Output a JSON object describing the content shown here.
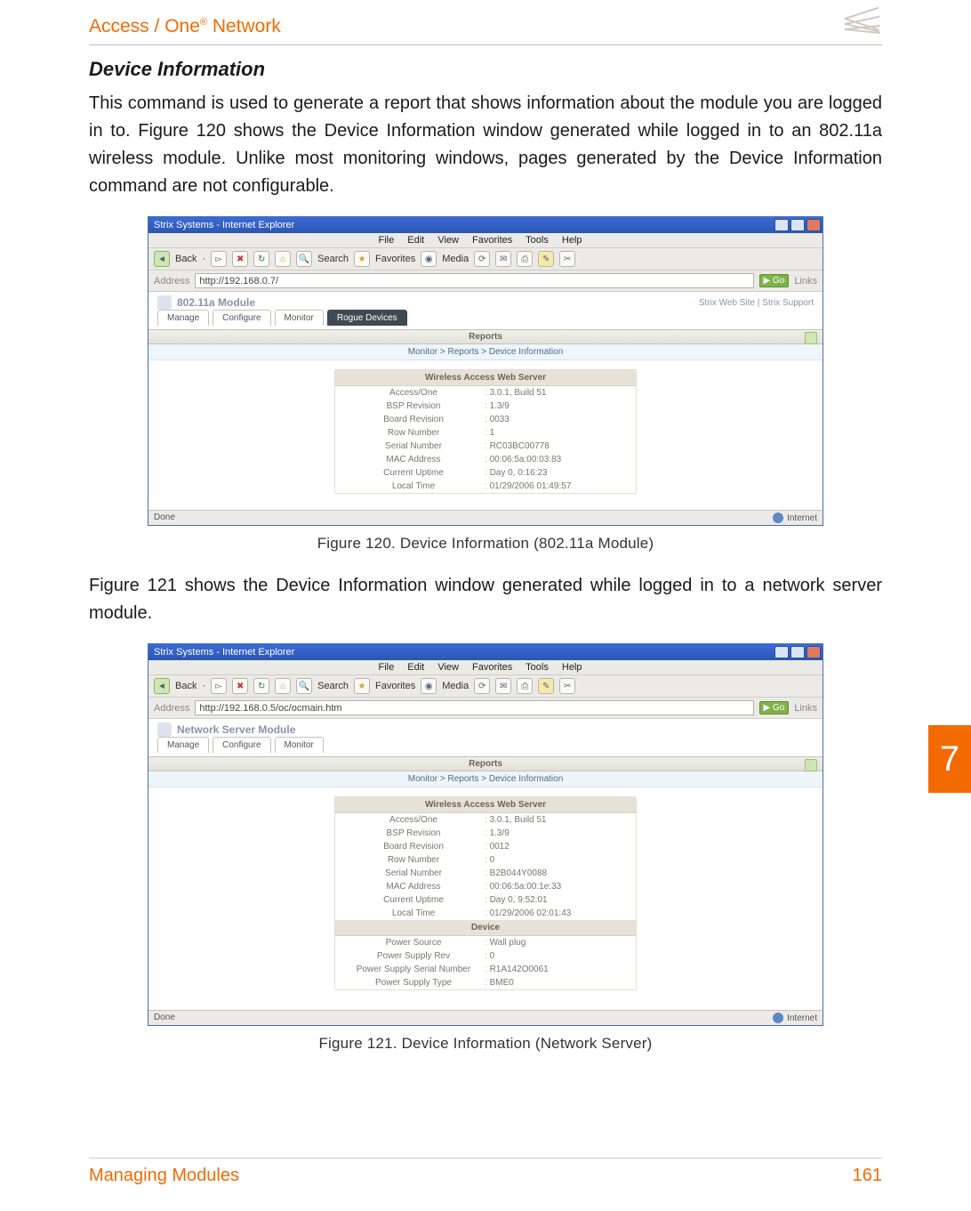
{
  "header": {
    "product_line": "Access / One",
    "reg": "®",
    "suffix": " Network"
  },
  "section_title": "Device Information",
  "para1": "This command is used to generate a report that shows information about the module you are logged in to. Figure 120 shows the Device Information window generated while logged in to an 802.11a wireless module. Unlike most monitoring windows, pages generated by the Device Information command are not configurable.",
  "para2": "Figure 121 shows the Device Information window generated while logged in to a network server module.",
  "fig120_caption": "Figure 120. Device Information (802.11a Module)",
  "fig121_caption": "Figure 121. Device Information (Network Server)",
  "chapter_tab": "7",
  "footer": {
    "left": "Managing Modules",
    "right": "161"
  },
  "ie": {
    "title": "Strix Systems - Internet Explorer",
    "menu": {
      "file": "File",
      "edit": "Edit",
      "view": "View",
      "favorites": "Favorites",
      "tools": "Tools",
      "help": "Help"
    },
    "toolbar": {
      "back": "Back",
      "search": "Search",
      "favorites": "Favorites",
      "media": "Media"
    },
    "addr_label": "Address",
    "go": "Go",
    "links": "Links",
    "status_done": "Done",
    "status_net": "Internet"
  },
  "screenshot120": {
    "url": "http://192.168.0.7/",
    "module": "802.11a Module",
    "top_links": "Strix Web Site  |  Strix Support",
    "tabs": {
      "manage": "Manage",
      "configure": "Configure",
      "monitor": "Monitor",
      "rogue": "Rogue Devices"
    },
    "reports_label": "Reports",
    "breadcrumb": "Monitor > Reports > Device Information",
    "card_header": "Wireless Access Web Server",
    "rows": [
      {
        "k": "Access/One",
        "v": "3.0.1, Build 51"
      },
      {
        "k": "BSP Revision",
        "v": "1.3/9"
      },
      {
        "k": "Board Revision",
        "v": "0033"
      },
      {
        "k": "Row Number",
        "v": "1"
      },
      {
        "k": "Serial Number",
        "v": "RC03BC00778"
      },
      {
        "k": "MAC Address",
        "v": "00:06:5a:00:03:83"
      },
      {
        "k": "Current Uptime",
        "v": "Day 0, 0:16:23"
      },
      {
        "k": "Local Time",
        "v": "01/29/2006 01:49:57"
      }
    ]
  },
  "screenshot121": {
    "url": "http://192.168.0.5/oc/ocmain.htm",
    "module": "Network Server Module",
    "tabs": {
      "manage": "Manage",
      "configure": "Configure",
      "monitor": "Monitor"
    },
    "reports_label": "Reports",
    "breadcrumb": "Monitor > Reports > Device Information",
    "card1_header": "Wireless Access Web Server",
    "rows1": [
      {
        "k": "Access/One",
        "v": "3.0.1, Build 51"
      },
      {
        "k": "BSP Revision",
        "v": "1.3/9"
      },
      {
        "k": "Board Revision",
        "v": "0012"
      },
      {
        "k": "Row Number",
        "v": "0"
      },
      {
        "k": "Serial Number",
        "v": "B2B044Y0088"
      },
      {
        "k": "MAC Address",
        "v": "00:06:5a:00:1e:33"
      },
      {
        "k": "Current Uptime",
        "v": "Day 0, 9:52:01"
      },
      {
        "k": "Local Time",
        "v": "01/29/2006 02:01:43"
      }
    ],
    "card2_header": "Device",
    "rows2": [
      {
        "k": "Power Source",
        "v": "Wall plug"
      },
      {
        "k": "Power Supply Rev",
        "v": "0"
      },
      {
        "k": "Power Supply Serial Number",
        "v": "R1A142O0061"
      },
      {
        "k": "Power Supply Type",
        "v": "BME0"
      }
    ]
  }
}
